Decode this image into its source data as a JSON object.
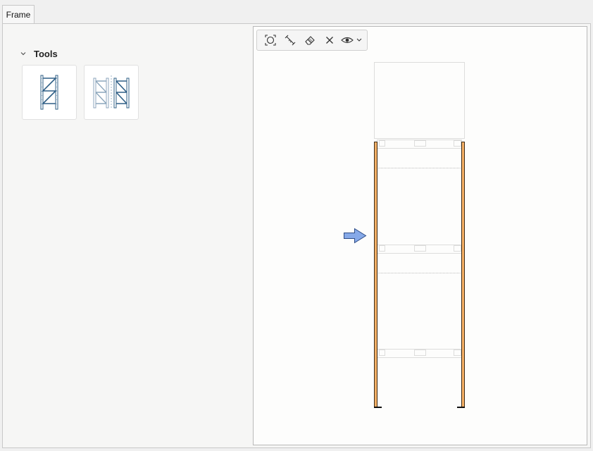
{
  "tabs": [
    {
      "label": "Frame",
      "active": true
    }
  ],
  "tools": {
    "section_label": "Tools",
    "expanded": true,
    "items": [
      {
        "icon": "single-frame-icon"
      },
      {
        "icon": "double-frame-icon"
      }
    ]
  },
  "toolbar": {
    "buttons": [
      {
        "icon": "zoom-fit-icon"
      },
      {
        "icon": "measure-icon"
      },
      {
        "icon": "eraser-icon"
      },
      {
        "icon": "close-icon"
      },
      {
        "icon": "eye-dropdown-icon"
      }
    ]
  },
  "colors": {
    "upright_fill": "#f5b066",
    "upright_stroke": "#3c2a14",
    "arrow_fill": "#86a9e8",
    "arrow_stroke": "#2d4c86",
    "dotted": "#bdbdbd",
    "icon_blue": "#2f5f86"
  }
}
